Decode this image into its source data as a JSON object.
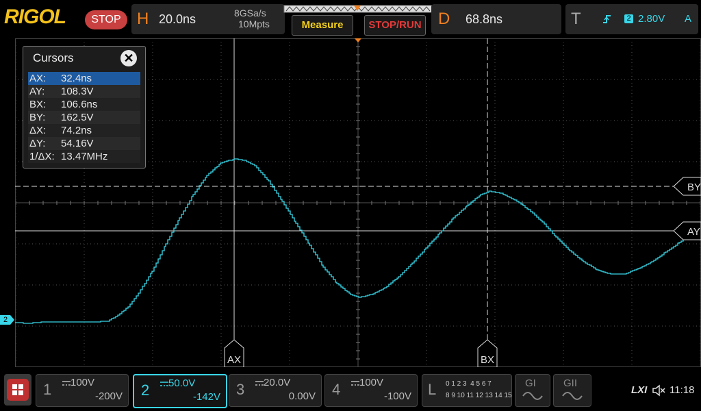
{
  "top": {
    "logo": "RIGOL",
    "run_state": "STOP",
    "horizontal": {
      "letter": "H",
      "timebase": "20.0ns",
      "sample_rate": "8GSa/s",
      "memory_depth": "10Mpts"
    },
    "measure_label": "Measure",
    "stoprun_label": "STOP/RUN",
    "delay": {
      "letter": "D",
      "value": "68.8ns"
    },
    "trigger": {
      "letter": "T",
      "channel": "2",
      "level": "2.80V",
      "mode": "A"
    }
  },
  "cursors_panel": {
    "title": "Cursors",
    "rows": [
      {
        "k": "AX:",
        "v": "32.4ns"
      },
      {
        "k": "AY:",
        "v": "108.3V"
      },
      {
        "k": "BX:",
        "v": "106.6ns"
      },
      {
        "k": "BY:",
        "v": "162.5V"
      },
      {
        "k": "ΔX:",
        "v": "74.2ns"
      },
      {
        "k": "ΔY:",
        "v": "54.16V"
      },
      {
        "k": "1/ΔX:",
        "v": "13.47MHz"
      }
    ]
  },
  "cursor_labels": {
    "ax": "AX",
    "bx": "BX",
    "ay": "AY",
    "by": "BY"
  },
  "channel_marker": "2",
  "bottom": {
    "channels": [
      {
        "num": "1",
        "scale": "100V",
        "offset": "-200V"
      },
      {
        "num": "2",
        "scale": "50.0V",
        "offset": "-142V"
      },
      {
        "num": "3",
        "scale": "20.0V",
        "offset": "0.00V"
      },
      {
        "num": "4",
        "scale": "100V",
        "offset": "-100V"
      }
    ],
    "logic": {
      "letter": "L",
      "row1": "0 1 2 3  4 5 6 7",
      "row2": "8 9 10 11 12 13 14 15"
    },
    "g1": "GI",
    "g2": "GII",
    "lxi": "LXI",
    "time": "11:18"
  },
  "colors": {
    "trace": "#38d6e8",
    "accent": "#f08020",
    "stop": "#c94040",
    "measure": "#f6d21a"
  }
}
